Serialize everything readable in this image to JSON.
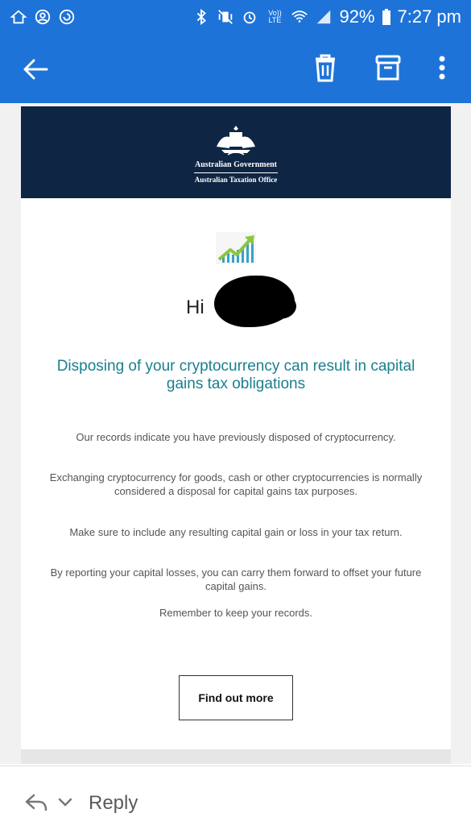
{
  "status_bar": {
    "battery": "92%",
    "time": "7:27 pm",
    "icons_left": [
      "home-outline-icon",
      "account-circle-icon",
      "sync-circle-icon"
    ],
    "icons_right": [
      "bluetooth-icon",
      "vibrate-mute-icon",
      "alarm-icon",
      "volte-icon",
      "wifi-icon",
      "signal-icon",
      "battery-icon"
    ],
    "volte_label": "Vo)) LTE"
  },
  "app_bar": {
    "background": "#1e73d8",
    "actions": [
      "back-arrow-icon",
      "delete-icon",
      "archive-icon",
      "more-vert-icon"
    ]
  },
  "email": {
    "header": {
      "background": "#0f2544",
      "org_line1": "Australian Government",
      "org_line2": "Australian Taxation Office"
    },
    "greeting": "Hi",
    "headline": "Disposing of your cryptocurrency can result in capital gains tax obligations",
    "paragraphs": [
      "Our records indicate you have previously disposed of cryptocurrency.",
      "Exchanging cryptocurrency for goods, cash or other cryptocurrencies is normally considered a disposal for capital gains tax purposes.",
      "Make sure to include any resulting capital gain or loss in your tax return.",
      "By reporting your capital losses, you can carry them forward to offset your future capital gains.",
      "Remember to keep your records."
    ],
    "cta_label": "Find out more",
    "headline_color": "#1a7f8e"
  },
  "reply_bar": {
    "label": "Reply"
  }
}
